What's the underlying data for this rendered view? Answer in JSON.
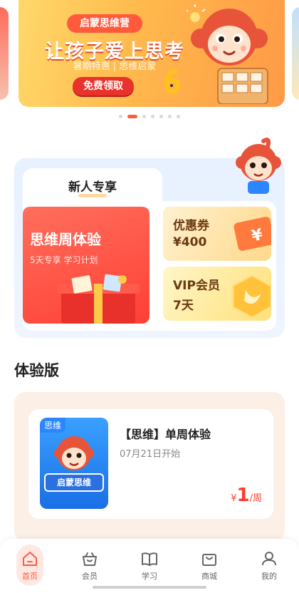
{
  "banner": {
    "tag": "启蒙思维营",
    "title": "让孩子爱上思考",
    "subtitle": "暑期特惠 | 思维启蒙",
    "button": "免费领取",
    "dots_total": 7,
    "active_dot": 1
  },
  "new_user": {
    "tab_label": "新人专享",
    "trial": {
      "title": "思维周体验",
      "subtitle": "5天专享  学习计划"
    },
    "coupon": {
      "title": "优惠券",
      "value": "¥400"
    },
    "vip": {
      "title": "VIP会员",
      "value": "7天"
    }
  },
  "experience": {
    "section_title": "体验版",
    "card": {
      "thumb_tag": "思维",
      "thumb_label": "启蒙思维",
      "title": "【思维】单周体验",
      "date": "07月21日开始",
      "price_currency": "¥",
      "price_amount": "1",
      "price_unit": "/周"
    }
  },
  "bottom_nav": {
    "items": [
      {
        "label": "首页",
        "icon": "home-icon",
        "active": true
      },
      {
        "label": "会员",
        "icon": "crown-basket-icon",
        "active": false
      },
      {
        "label": "学习",
        "icon": "book-icon",
        "active": false
      },
      {
        "label": "商城",
        "icon": "shopping-bag-icon",
        "active": false
      },
      {
        "label": "我的",
        "icon": "user-icon",
        "active": false
      }
    ]
  },
  "colors": {
    "accent": "#ff5a3c",
    "price": "#ff3b30",
    "banner_bg": "#ffb84c",
    "new_user_bg": "#e7f1ff",
    "experience_bg": "#fcefe6"
  }
}
